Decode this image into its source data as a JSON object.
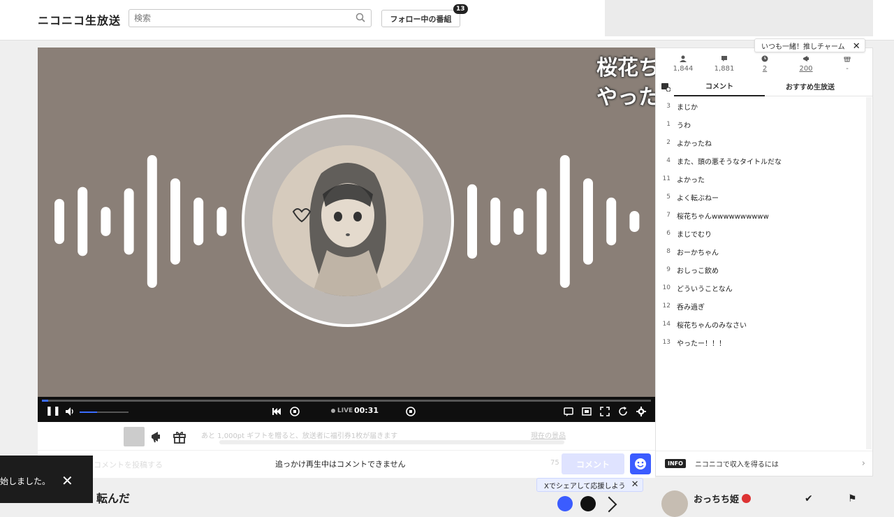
{
  "header": {
    "logo": "ニコニコ生放送",
    "search_placeholder": "検索",
    "follow_label": "フォロー中の番組",
    "follow_badge": "13"
  },
  "player": {
    "overlay_line1": "桜花ち",
    "overlay_line2": "やった",
    "live_label": "LIVE",
    "time": "00:31",
    "seek_progress_fraction": 0.01,
    "volume_fraction": 0.35,
    "bar_levels_left": [
      0.34,
      0.52,
      0.22,
      0.5,
      1.0,
      0.65,
      0.36,
      0.22
    ],
    "bar_levels_right": [
      0.56,
      0.36,
      0.2,
      0.5,
      1.0,
      0.65,
      0.36,
      0.14
    ]
  },
  "gift_bar": {
    "message": "あと 1,000pt ギフトを贈ると、放送者に福引券1枚が届きます",
    "link": "現在の景品"
  },
  "comment_bar": {
    "placeholder": "コメントを投稿する",
    "disabled_message": "追っかけ再生中はコメントできません",
    "count": "75",
    "button": "コメント"
  },
  "sidebar": {
    "pinned_tag": "いつも一緒！推しチャーム",
    "stats": [
      {
        "icon": "viewers-icon",
        "value": "1,844"
      },
      {
        "icon": "comments-count-icon",
        "value": "1,881"
      },
      {
        "icon": "clock-icon",
        "value": "2"
      },
      {
        "icon": "megaphone-icon",
        "value": "200"
      },
      {
        "icon": "gift-icon",
        "value": "-"
      }
    ],
    "tabs": [
      "コメント",
      "おすすめ生放送"
    ],
    "comments": [
      {
        "num": "3",
        "text": "まじか"
      },
      {
        "num": "1",
        "text": "うわ"
      },
      {
        "num": "2",
        "text": "よかったね"
      },
      {
        "num": "4",
        "text": "また、頭の悪そうなタイトルだな"
      },
      {
        "num": "11",
        "text": "よかった"
      },
      {
        "num": "5",
        "text": "よく転ぶねー"
      },
      {
        "num": "7",
        "text": "桜花ちゃんwwwwwwwwww"
      },
      {
        "num": "6",
        "text": "まじでむり"
      },
      {
        "num": "8",
        "text": "おーかちゃん"
      },
      {
        "num": "9",
        "text": "おしっこ飲め"
      },
      {
        "num": "10",
        "text": "どういうことなん"
      },
      {
        "num": "12",
        "text": "呑み過ぎ"
      },
      {
        "num": "14",
        "text": "桜花ちゃんのみなさい"
      },
      {
        "num": "13",
        "text": "やったー！！！"
      }
    ],
    "info_badge": "INFO",
    "info_text": "ニコニコで収入を得るには"
  },
  "bottom": {
    "toast_text": "始しました。",
    "title_fragment": "転んだ",
    "share_tip": "Xでシェアして応援しよう",
    "streamer_name": "おっちち姫"
  },
  "colors": {
    "accent": "#3b5cff",
    "player_bg": "#8a7f77"
  }
}
